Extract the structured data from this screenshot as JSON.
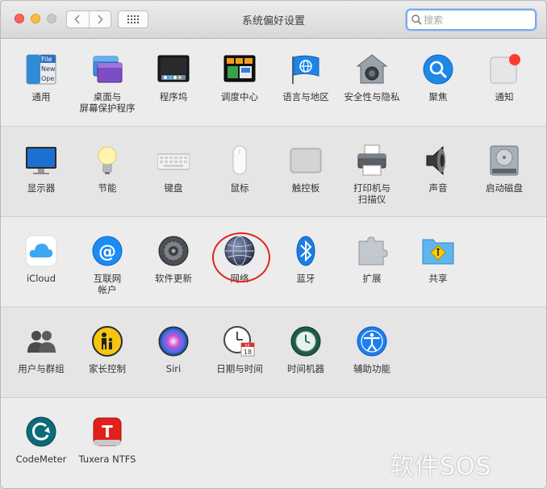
{
  "window": {
    "title": "系统偏好设置"
  },
  "toolbar": {
    "back_glyph": "〈",
    "forward_glyph": "〉",
    "grid_icon": "grid-icon"
  },
  "search": {
    "placeholder": "搜索",
    "value": ""
  },
  "rows": [
    {
      "panes": [
        {
          "label": "通用",
          "icon": "general-icon"
        },
        {
          "label": "桌面与\n屏幕保护程序",
          "icon": "desktop-screensaver-icon"
        },
        {
          "label": "程序坞",
          "icon": "dock-icon"
        },
        {
          "label": "调度中心",
          "icon": "mission-control-icon"
        },
        {
          "label": "语言与地区",
          "icon": "language-region-icon"
        },
        {
          "label": "安全性与隐私",
          "icon": "security-privacy-icon"
        },
        {
          "label": "聚焦",
          "icon": "spotlight-icon"
        },
        {
          "label": "通知",
          "icon": "notifications-icon"
        }
      ]
    },
    {
      "panes": [
        {
          "label": "显示器",
          "icon": "displays-icon"
        },
        {
          "label": "节能",
          "icon": "energy-saver-icon"
        },
        {
          "label": "键盘",
          "icon": "keyboard-icon"
        },
        {
          "label": "鼠标",
          "icon": "mouse-icon"
        },
        {
          "label": "触控板",
          "icon": "trackpad-icon"
        },
        {
          "label": "打印机与\n扫描仪",
          "icon": "printers-scanners-icon"
        },
        {
          "label": "声音",
          "icon": "sound-icon"
        },
        {
          "label": "启动磁盘",
          "icon": "startup-disk-icon"
        }
      ]
    },
    {
      "panes": [
        {
          "label": "iCloud",
          "icon": "icloud-icon"
        },
        {
          "label": "互联网\n帐户",
          "icon": "internet-accounts-icon"
        },
        {
          "label": "软件更新",
          "icon": "software-update-icon"
        },
        {
          "label": "网络",
          "icon": "network-icon"
        },
        {
          "label": "蓝牙",
          "icon": "bluetooth-icon"
        },
        {
          "label": "扩展",
          "icon": "extensions-icon"
        },
        {
          "label": "共享",
          "icon": "sharing-icon"
        }
      ]
    },
    {
      "panes": [
        {
          "label": "用户与群组",
          "icon": "users-groups-icon"
        },
        {
          "label": "家长控制",
          "icon": "parental-controls-icon"
        },
        {
          "label": "Siri",
          "icon": "siri-icon"
        },
        {
          "label": "日期与时间",
          "icon": "date-time-icon"
        },
        {
          "label": "时间机器",
          "icon": "time-machine-icon"
        },
        {
          "label": "辅助功能",
          "icon": "accessibility-icon"
        }
      ]
    },
    {
      "panes": [
        {
          "label": "CodeMeter",
          "icon": "codemeter-icon"
        },
        {
          "label": "Tuxera NTFS",
          "icon": "tuxera-ntfs-icon"
        }
      ]
    }
  ],
  "date_icon": {
    "month": "JUL",
    "day": "18"
  },
  "general_icon_text": {
    "line1": "File",
    "line2": "New",
    "line3": "Ope"
  },
  "highlight": {
    "target": "网络",
    "color": "#e0251b"
  },
  "watermark": {
    "text": "软件SOS"
  },
  "colors": {
    "accent_blue": "#7fa9e6",
    "close": "#fc615d",
    "minimize": "#fdbc40",
    "badge_red": "#ff3b30"
  }
}
